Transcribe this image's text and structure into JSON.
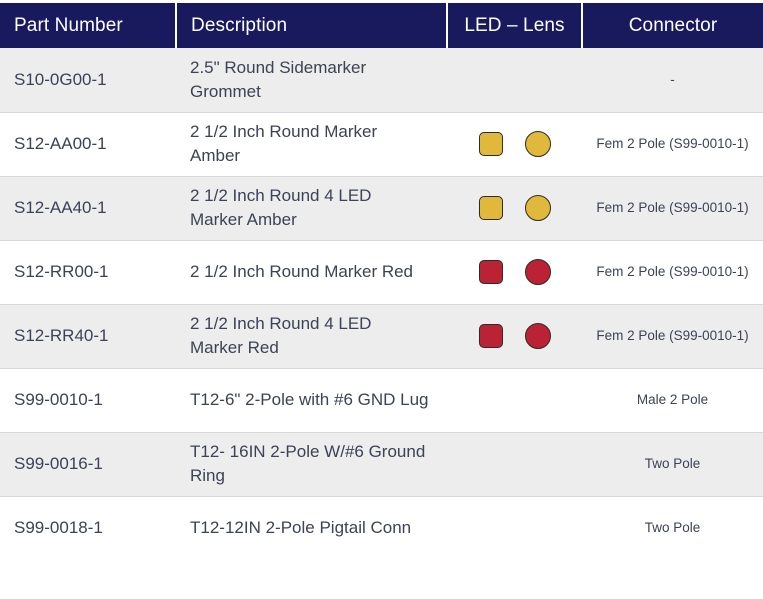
{
  "table": {
    "columns": [
      {
        "key": "part",
        "label": "Part Number",
        "align": "left"
      },
      {
        "key": "description",
        "label": "Description",
        "align": "left"
      },
      {
        "key": "led_lens",
        "label": "LED – Lens",
        "align": "center"
      },
      {
        "key": "connector",
        "label": "Connector",
        "align": "center"
      }
    ],
    "header_background": "#191A5E",
    "header_text_color": "#FFFFFF",
    "row_shade_color": "#EDEDED",
    "row_plain_color": "#FFFFFF",
    "body_text_color": "#3C4257",
    "swatch_colors": {
      "amber": "#E0B83C",
      "red": "#BB2233",
      "border": "#2B2B2B"
    },
    "rows": [
      {
        "part": "S10-0G00-1",
        "description": "2.5\" Round Sidemarker Grommet",
        "swatches": [],
        "connector": "-",
        "shaded": true
      },
      {
        "part": "S12-AA00-1",
        "description": "2 1/2 Inch Round Marker Amber",
        "swatches": [
          {
            "shape": "square",
            "color": "amber"
          },
          {
            "shape": "circle",
            "color": "amber"
          }
        ],
        "connector": "Fem 2 Pole (S99-0010-1)",
        "shaded": false
      },
      {
        "part": "S12-AA40-1",
        "description": "2 1/2 Inch Round 4 LED Marker Amber",
        "swatches": [
          {
            "shape": "square",
            "color": "amber"
          },
          {
            "shape": "circle",
            "color": "amber"
          }
        ],
        "connector": "Fem 2 Pole (S99-0010-1)",
        "shaded": true
      },
      {
        "part": "S12-RR00-1",
        "description": "2 1/2 Inch Round Marker Red",
        "swatches": [
          {
            "shape": "square",
            "color": "red"
          },
          {
            "shape": "circle",
            "color": "red"
          }
        ],
        "connector": "Fem 2 Pole (S99-0010-1)",
        "shaded": false
      },
      {
        "part": "S12-RR40-1",
        "description": "2 1/2 Inch Round 4 LED Marker Red",
        "swatches": [
          {
            "shape": "square",
            "color": "red"
          },
          {
            "shape": "circle",
            "color": "red"
          }
        ],
        "connector": "Fem 2 Pole (S99-0010-1)",
        "shaded": true
      },
      {
        "part": "S99-0010-1",
        "description": "T12-6\" 2-Pole with #6 GND Lug",
        "swatches": [],
        "connector": "Male 2 Pole",
        "shaded": false
      },
      {
        "part": "S99-0016-1",
        "description": "T12- 16IN 2-Pole W/#6 Ground Ring",
        "swatches": [],
        "connector": "Two Pole",
        "shaded": true
      },
      {
        "part": "S99-0018-1",
        "description": "T12-12IN 2-Pole Pigtail Conn",
        "swatches": [],
        "connector": "Two Pole",
        "shaded": false
      }
    ]
  }
}
